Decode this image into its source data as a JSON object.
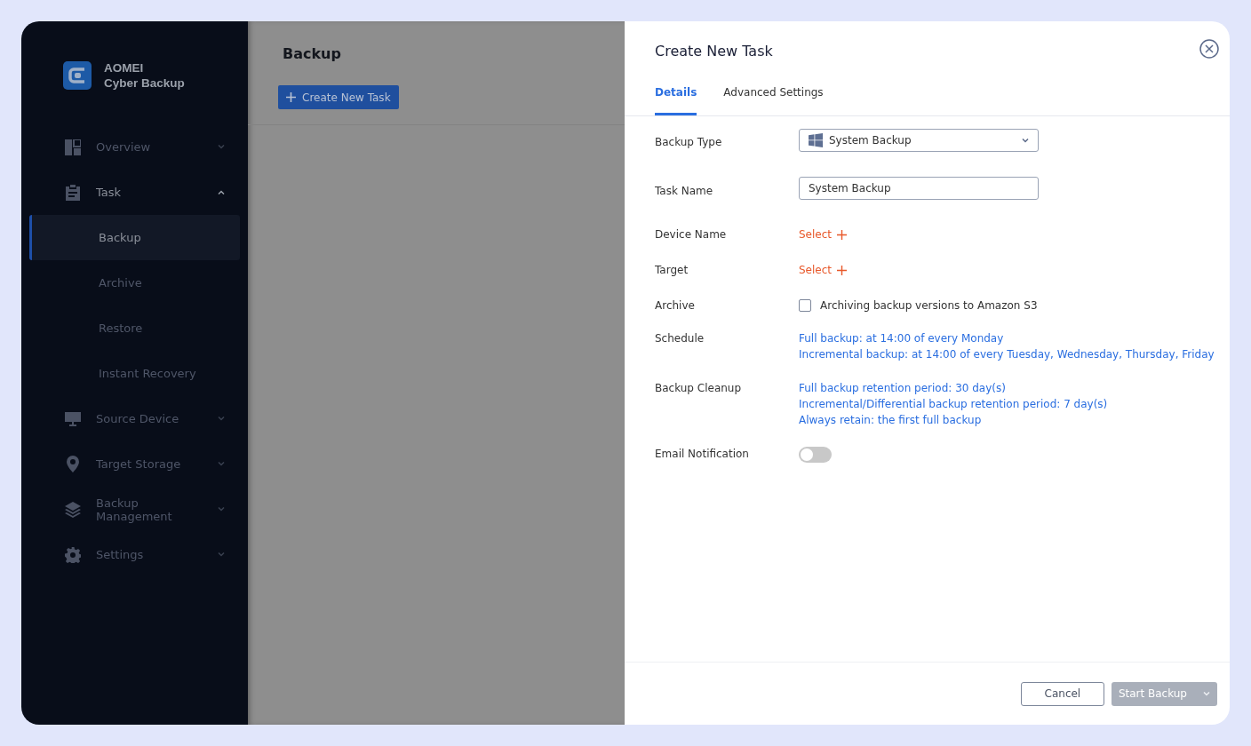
{
  "sidebar": {
    "logo": {
      "line1": "AOMEI",
      "line2": "Cyber Backup"
    },
    "items": [
      {
        "label": "Overview",
        "expanded": false
      },
      {
        "label": "Task",
        "expanded": true,
        "children": [
          {
            "label": "Backup",
            "selected": true
          },
          {
            "label": "Archive",
            "selected": false
          },
          {
            "label": "Restore",
            "selected": false
          },
          {
            "label": "Instant Recovery",
            "selected": false
          }
        ]
      },
      {
        "label": "Source Device",
        "expanded": false
      },
      {
        "label": "Target Storage",
        "expanded": false
      },
      {
        "label": "Backup Management",
        "expanded": false
      },
      {
        "label": "Settings",
        "expanded": false
      }
    ]
  },
  "main": {
    "title": "Backup",
    "create_button": "Create New Task"
  },
  "drawer": {
    "title": "Create New Task",
    "tabs": [
      {
        "label": "Details",
        "selected": true
      },
      {
        "label": "Advanced Settings",
        "selected": false
      }
    ],
    "fields": [
      {
        "kind": "select",
        "label": "Backup Type",
        "value": "System Backup"
      },
      {
        "kind": "text",
        "label": "Task Name",
        "value": "System Backup"
      },
      {
        "kind": "picker",
        "label": "Device Name",
        "action": "Select"
      },
      {
        "kind": "picker",
        "label": "Target",
        "action": "Select"
      },
      {
        "kind": "checkbox",
        "label": "Archive",
        "checked": false,
        "text": "Archiving backup versions to Amazon S3"
      },
      {
        "kind": "links",
        "label": "Schedule",
        "lines": [
          "Full backup: at 14:00 of every Monday",
          "Incremental backup: at 14:00 of every Tuesday, Wednesday, Thursday, Friday"
        ]
      },
      {
        "kind": "links",
        "label": "Backup Cleanup",
        "lines": [
          "Full backup retention period: 30 day(s)",
          "Incremental/Differential backup retention period: 7 day(s)",
          "Always retain: the first full backup"
        ]
      },
      {
        "kind": "toggle",
        "label": "Email Notification",
        "on": false
      }
    ],
    "footer": {
      "cancel": "Cancel",
      "start": {
        "label": "Start Backup",
        "disabled": true
      }
    }
  }
}
